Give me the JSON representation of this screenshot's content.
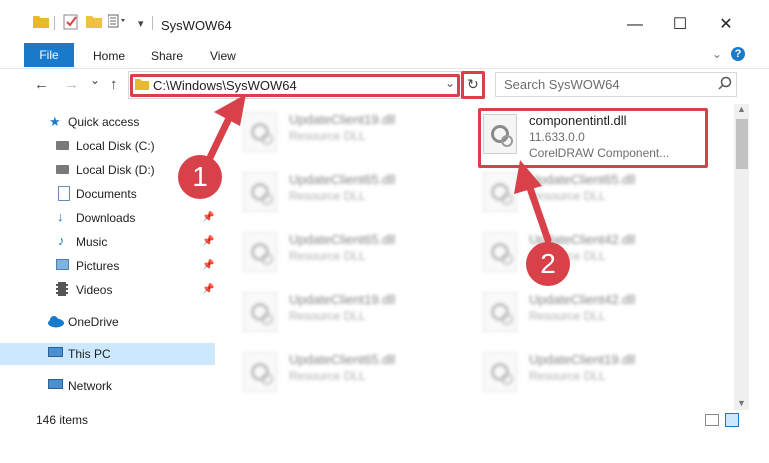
{
  "window": {
    "title": "SysWOW64",
    "minimize": "—",
    "maximize": "☐",
    "close": "✕"
  },
  "ribbon": {
    "file": "File",
    "home": "Home",
    "share": "Share",
    "view": "View",
    "help": "?"
  },
  "nav": {
    "back": "←",
    "forward": "→",
    "recent": "⌄",
    "up": "↑",
    "address": "C:\\Windows\\SysWOW64",
    "refresh": "↻",
    "dropdown": "⌄"
  },
  "search": {
    "placeholder": "Search SysWOW64"
  },
  "sidebar": {
    "items": [
      {
        "label": "Quick access",
        "icon": "star-icon",
        "pinned": false
      },
      {
        "label": "Local Disk (C:)",
        "icon": "drive-icon",
        "pinned": false
      },
      {
        "label": "Local Disk (D:)",
        "icon": "drive-icon",
        "pinned": false
      },
      {
        "label": "Documents",
        "icon": "documents-icon",
        "pinned": true
      },
      {
        "label": "Downloads",
        "icon": "downloads-icon",
        "pinned": true
      },
      {
        "label": "Music",
        "icon": "music-icon",
        "pinned": true
      },
      {
        "label": "Pictures",
        "icon": "pictures-icon",
        "pinned": true
      },
      {
        "label": "Videos",
        "icon": "videos-icon",
        "pinned": true
      },
      {
        "label": "OneDrive",
        "icon": "onedrive-icon",
        "pinned": false
      },
      {
        "label": "This PC",
        "icon": "pc-icon",
        "pinned": false
      },
      {
        "label": "Network",
        "icon": "network-icon",
        "pinned": false
      }
    ]
  },
  "files": [
    {
      "name": "UpdateClient19.dll",
      "type": "Resource DLL"
    },
    {
      "name": "componentintl.dll",
      "version": "11.633.0.0",
      "desc": "CorelDRAW Component..."
    },
    {
      "name": "UpdateClient65.dll",
      "type": "Resource DLL"
    },
    {
      "name": "UpdateClient65.dll",
      "type": "Resource DLL"
    },
    {
      "name": "UpdateClient65.dll",
      "type": "Resource DLL"
    },
    {
      "name": "UpdateClient42.dll",
      "type": "Resource DLL"
    },
    {
      "name": "UpdateClient19.dll",
      "type": "Resource DLL"
    },
    {
      "name": "UpdateClient42.dll",
      "type": "Resource DLL"
    },
    {
      "name": "UpdateClient65.dll",
      "type": "Resource DLL"
    },
    {
      "name": "UpdateClient19.dll",
      "type": "Resource DLL"
    }
  ],
  "annotations": {
    "step1": "1",
    "step2": "2"
  },
  "status": {
    "items": "146 items"
  },
  "colors": {
    "accent": "#1979ca",
    "highlight": "#d9414a",
    "selected": "#cce8ff"
  }
}
